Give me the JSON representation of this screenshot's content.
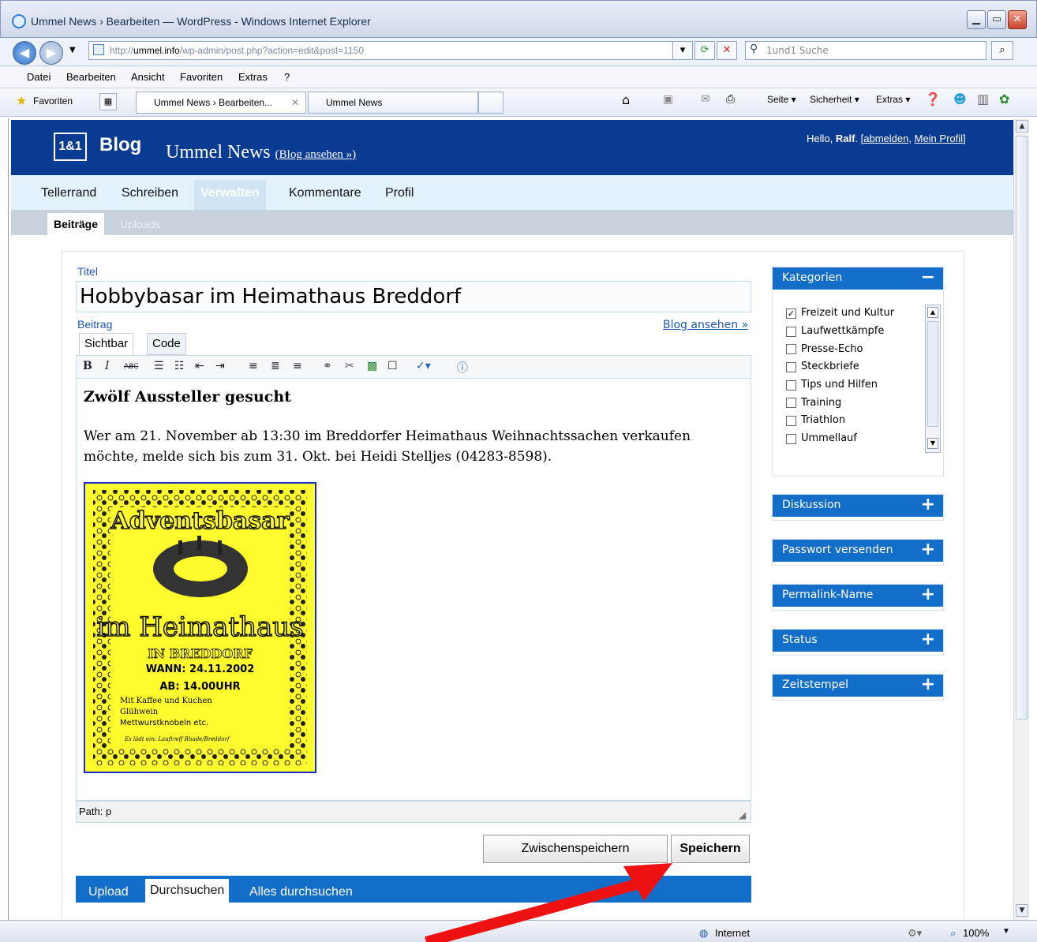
{
  "window": {
    "title": "Ummel News › Bearbeiten — WordPress - Windows Internet Explorer",
    "min": "▁",
    "max": "▭",
    "close": "✕"
  },
  "address": {
    "prefix": "http://",
    "domain": "ummel.info",
    "path": "/wp-admin/post.php?action=edit&post=1150",
    "search_placeholder": "1und1 Suche"
  },
  "menubar": [
    "Datei",
    "Bearbeiten",
    "Ansicht",
    "Favoriten",
    "Extras",
    "?"
  ],
  "tabbar": {
    "favorites": "Favoriten",
    "tabs": [
      "Ummel News › Bearbeiten...",
      "Ummel News"
    ],
    "commands": [
      "Seite ▾",
      "Sicherheit ▾",
      "Extras ▾"
    ]
  },
  "wp": {
    "logo": "1&1",
    "blog": "Blog",
    "site": "Ummel News",
    "view_blog": "(Blog ansehen »)",
    "hello_prefix": "Hello, ",
    "user": "Ralf",
    "logout": "abmelden",
    "profile": "Mein Profil",
    "nav": [
      "Tellerrand",
      "Schreiben",
      "Verwalten",
      "Kommentare",
      "Profil"
    ],
    "subnav": [
      "Beiträge",
      "Uploads"
    ]
  },
  "post": {
    "title_label": "Titel",
    "title": "Hobbybasar im Heimathaus Breddorf",
    "body_label": "Beitrag",
    "view_link": "Blog ansehen »",
    "tabs": [
      "Sichtbar",
      "Code"
    ],
    "heading": "Zwölf Aussteller gesucht",
    "paragraph": "Wer am 21. November ab 13:30 im Breddorfer Heimathaus Weihnachtssachen verkaufen möchte, melde sich bis zum 31. Okt. bei Heidi Stelljes (04283-8598).",
    "path": "Path: p",
    "save_draft": "Zwischenspeichern",
    "save": "Speichern"
  },
  "poster": {
    "title": "Adventsbasar",
    "line1": "im Heimathaus",
    "line2": "IN BREDDORF",
    "when": "WANN: 24.11.2002",
    "time": "AB: 14.00UHR",
    "info1": "Mit Kaffee und Kuchen",
    "info2": "Glühwein",
    "info3": "Mettwurstknobeln etc.",
    "footer": "Es lädt ein: Lauftreff Rhade/Breddorf"
  },
  "upload": [
    "Upload",
    "Durchsuchen",
    "Alles durchsuchen"
  ],
  "sidebar": {
    "categories_title": "Kategorien",
    "categories": [
      {
        "name": "Freizeit und Kultur",
        "checked": true
      },
      {
        "name": "Laufwettkämpfe",
        "checked": false
      },
      {
        "name": "Presse-Echo",
        "checked": false
      },
      {
        "name": "Steckbriefe",
        "checked": false
      },
      {
        "name": "Tips und Hilfen",
        "checked": false
      },
      {
        "name": "Training",
        "checked": false
      },
      {
        "name": "Triathlon",
        "checked": false
      },
      {
        "name": "Ummellauf",
        "checked": false
      }
    ],
    "boxes": [
      "Diskussion",
      "Passwort versenden",
      "Permalink-Name",
      "Status",
      "Zeitstempel"
    ]
  },
  "statusbar": {
    "zone": "Internet",
    "zoom": "100%"
  },
  "colors": {
    "wp_header": "#0a3b93",
    "box_header": "#136ec9",
    "annotation_arrow": "#ee1111"
  }
}
